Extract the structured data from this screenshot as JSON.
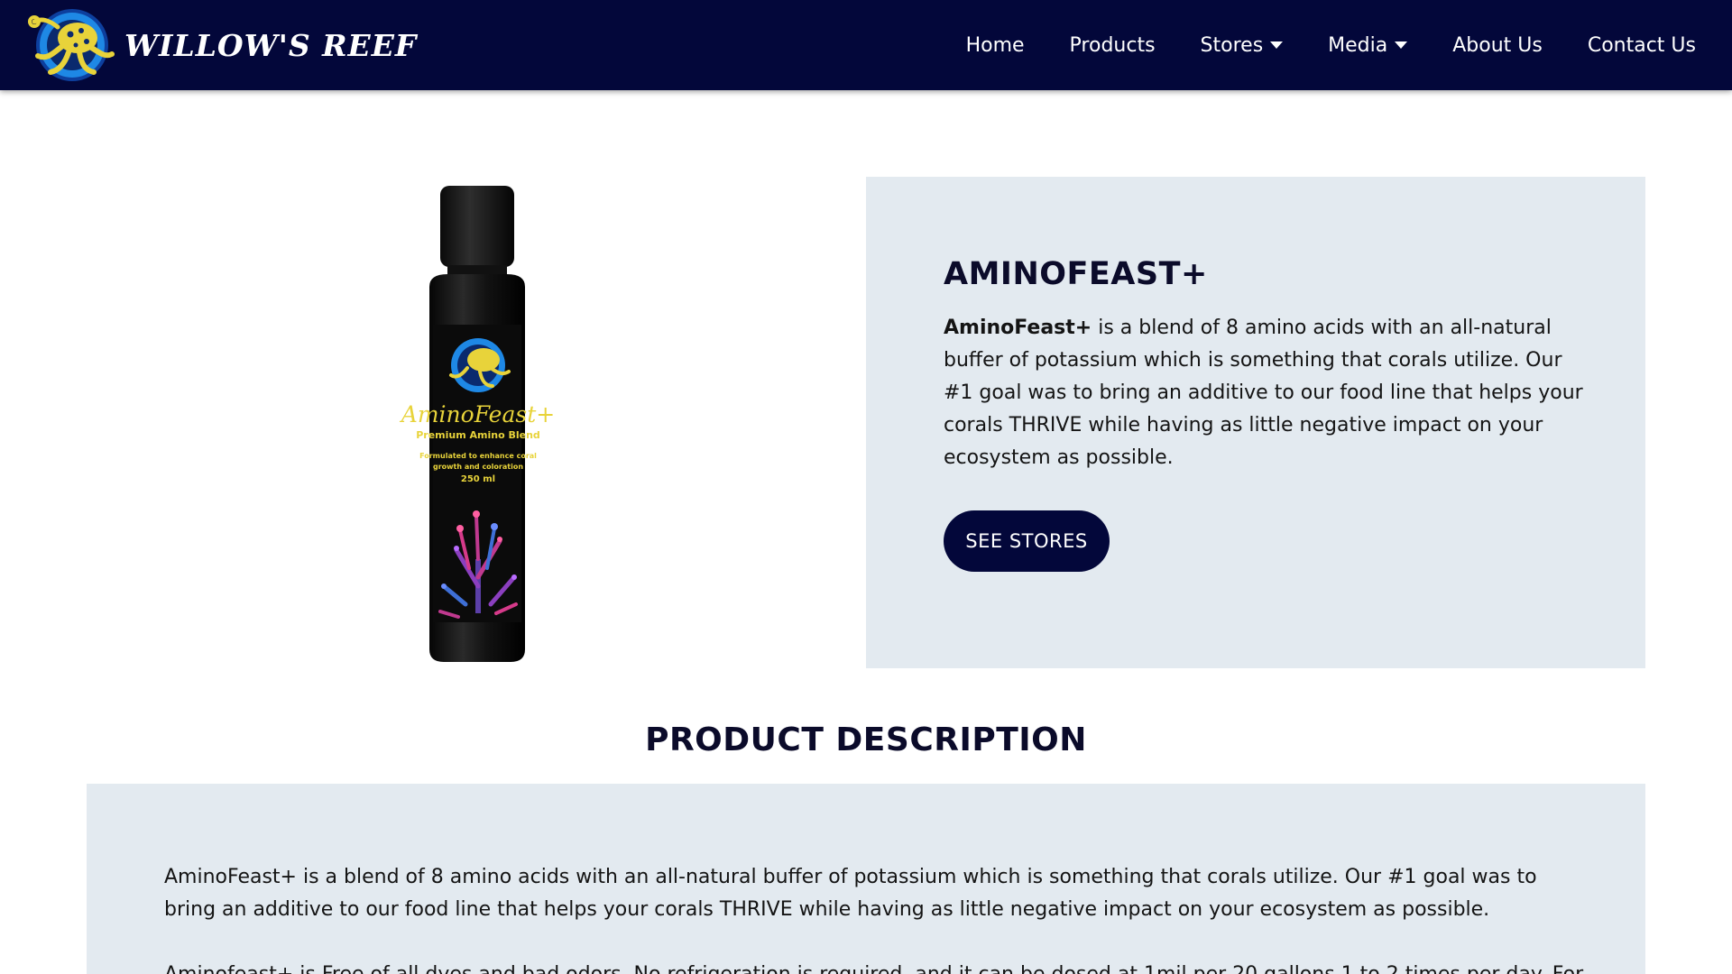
{
  "header": {
    "brand_name": "WILLOW'S REEF",
    "nav": [
      {
        "label": "Home",
        "has_dropdown": false
      },
      {
        "label": "Products",
        "has_dropdown": false
      },
      {
        "label": "Stores",
        "has_dropdown": true
      },
      {
        "label": "Media",
        "has_dropdown": true
      },
      {
        "label": "About Us",
        "has_dropdown": false
      },
      {
        "label": "Contact Us",
        "has_dropdown": false
      }
    ]
  },
  "product": {
    "title": "AMINOFEAST+",
    "intro_bold": "AminoFeast+",
    "intro_rest": " is a blend of 8 amino acids with an all-natural buffer of potassium which is something that corals utilize. Our #1 goal was to bring an additive to our food line that helps your corals THRIVE while having as little negative impact on your ecosystem as possible.",
    "cta_label": "SEE STORES",
    "bottle_label": {
      "name": "AminoFeast+",
      "subtitle": "Premium Amino Blend",
      "tagline_1": "Formulated to enhance coral",
      "tagline_2": "growth and coloration",
      "volume": "250 ml"
    }
  },
  "description": {
    "heading": "PRODUCT DESCRIPTION",
    "paragraph_1": "AminoFeast+ is a blend of 8 amino acids with an all-natural buffer of potassium which is something that corals utilize. Our #1 goal was to bring an additive to our food line that helps your corals THRIVE while having as little negative impact on your ecosystem as possible.",
    "paragraph_2": "Aminofeast+ is Free of all dyes and bad odors. No refrigeration is required, and it can be dosed at 1mil per 20 gallons 1 to 2 times per day. For"
  },
  "colors": {
    "navy": "#03073a",
    "panel": "#e3eaf0",
    "logo_yellow": "#e8d33a",
    "logo_blue": "#1e88e5"
  },
  "icons": {
    "logo": "octopus-logo-icon",
    "dropdown": "caret-down-icon"
  }
}
